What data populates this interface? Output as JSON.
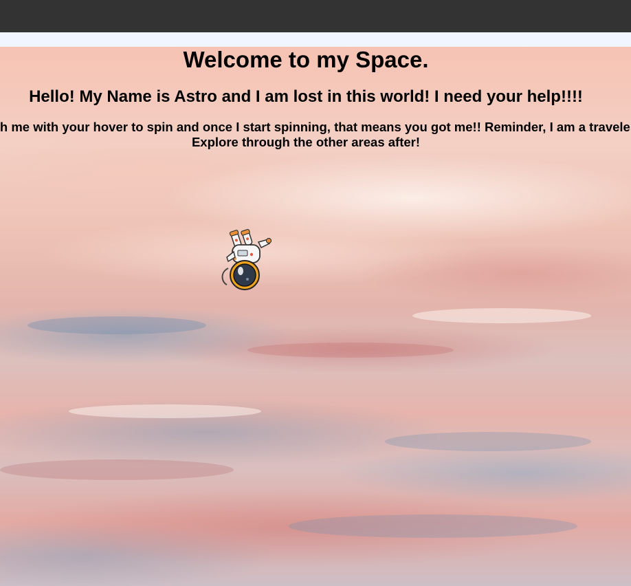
{
  "page": {
    "heading": "Welcome to my Space.",
    "subheading": "Hello! My Name is Astro and I am lost in this world! I need your help!!!!",
    "instructions_line1": "Catch me with your hover to spin and once I start spinning, that means you got me!! Reminder, I am a traveler!",
    "instructions_line2": "Explore through the other areas after!"
  },
  "character": {
    "icon": "astronaut-icon"
  },
  "colors": {
    "topbar": "#333333",
    "subbar": "#f1f5ff",
    "text": "#000000"
  }
}
